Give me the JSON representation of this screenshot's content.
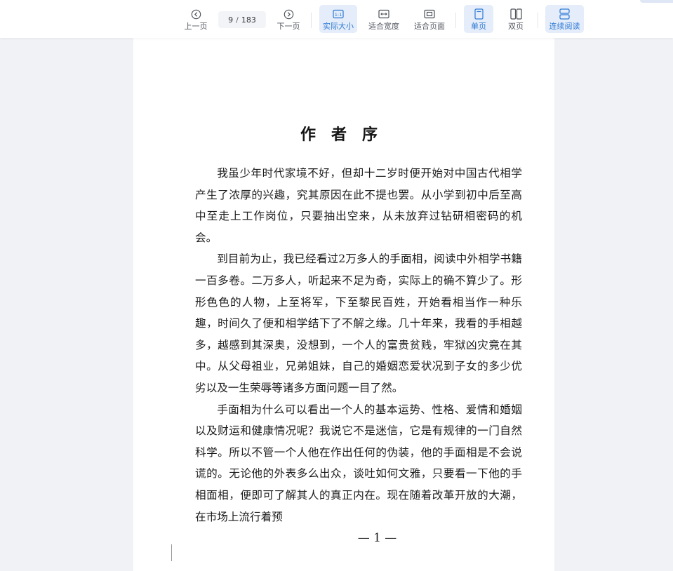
{
  "toolbar": {
    "prev_label": "上一页",
    "next_label": "下一页",
    "current_page": "9",
    "page_sep": "/",
    "total_pages": "183",
    "actual_size_label": "实际大小",
    "fit_width_label": "适合宽度",
    "fit_page_label": "适合页面",
    "single_page_label": "单页",
    "double_page_label": "双页",
    "continuous_label": "连续阅读",
    "accent_color": "#2d78d6",
    "active_bg": "#e4edf9"
  },
  "document": {
    "title": "作者序",
    "paragraphs": [
      "我虽少年时代家境不好，但却十二岁时便开始对中国古代相学产生了浓厚的兴趣，究其原因在此不提也罢。从小学到初中后至高中至走上工作岗位，只要抽出空来，从未放弃过钻研相密码的机会。",
      "到目前为止，我已经看过2万多人的手面相，阅读中外相学书籍一百多卷。二万多人，听起来不足为奇，实际上的确不算少了。形形色色的人物，上至将军，下至黎民百姓，开始看相当作一种乐趣，时间久了便和相学结下了不解之缘。几十年来，我看的手相越多，越感到其深奥，没想到，一个人的富贵贫贱，牢狱凶灾竟在其中。从父母祖业，兄弟姐妹，自己的婚姻恋爱状况到子女的多少优劣以及一生荣辱等诸多方面问题一目了然。",
      "手面相为什么可以看出一个人的基本运势、性格、爱情和婚姻以及财运和健康情况呢？我说它不是迷信，它是有规律的一门自然科学。所以不管一个人他在作出任何的伪装，他的手面相是不会说谎的。无论他的外表多么出众，谈吐如何文雅，只要看一下他的手相面相，便即可了解其人的真正内在。现在随着改革开放的大潮，在市场上流行着预"
    ],
    "page_number": "— 1 —"
  }
}
